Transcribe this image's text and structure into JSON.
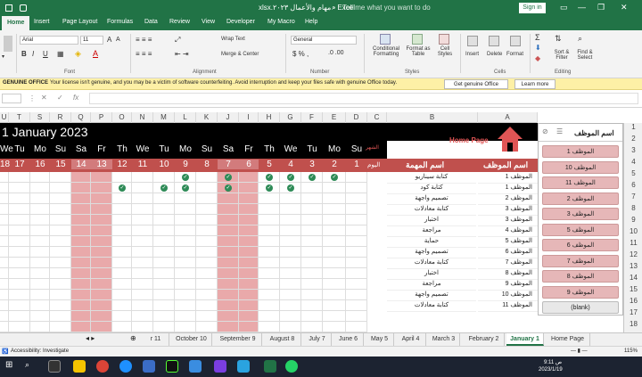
{
  "window": {
    "title": "Excel - مهام والأعمال ٢٠٢٣.xlsx",
    "sign_in": "Sign in"
  },
  "tabs": [
    "Home",
    "Insert",
    "Page Layout",
    "Formulas",
    "Data",
    "Review",
    "View",
    "Developer",
    "My Macro",
    "Help",
    "Tell me what you want to do"
  ],
  "ribbon": {
    "font_name": "Arial",
    "font_size": "11",
    "wrap_text": "Wrap Text",
    "merge_center": "Merge & Center",
    "number_format": "General",
    "conditional_formatting": "Conditional Formatting",
    "format_as_table": "Format as Table",
    "cell_styles": "Cell Styles",
    "insert": "Insert",
    "delete": "Delete",
    "format": "Format",
    "sort_filter": "Sort & Filter",
    "find_select": "Find & Select",
    "groups": [
      "Font",
      "Alignment",
      "Number",
      "Styles",
      "Cells",
      "Editing"
    ]
  },
  "message_bar": {
    "label": "GENUINE OFFICE",
    "text": "Your license isn't genuine, and you may be a victim of software counterfeiting. Avoid interruption and keep your files safe with genuine Office today.",
    "get_genuine": "Get genuine Office",
    "learn_more": "Learn more"
  },
  "columns": [
    "U",
    "T",
    "S",
    "R",
    "Q",
    "P",
    "O",
    "N",
    "M",
    "L",
    "K",
    "J",
    "I",
    "H",
    "G",
    "F",
    "E",
    "D",
    "C",
    "B",
    "A"
  ],
  "sheet": {
    "title": "1 January 2023",
    "home_page": "Home Page",
    "day_names": [
      "We",
      "Tu",
      "Mo",
      "Su",
      "Sa",
      "Fr",
      "Th",
      "We",
      "Tu",
      "Mo",
      "Su",
      "Sa",
      "Fr",
      "Th",
      "We",
      "Tu",
      "Mo",
      "Su"
    ],
    "day_numbers": [
      "18",
      "17",
      "16",
      "15",
      "14",
      "13",
      "12",
      "11",
      "10",
      "9",
      "8",
      "7",
      "6",
      "5",
      "4",
      "3",
      "2",
      "1"
    ],
    "month_label": "الشهر",
    "day_label": "اليوم",
    "col_task": "اسم المهمة",
    "col_employee": "اسم الموظف",
    "rows": [
      {
        "employee": "الموظف 1",
        "task": "كتابة سيناريو"
      },
      {
        "employee": "الموظف 1",
        "task": "كتابة كود"
      },
      {
        "employee": "الموظف 2",
        "task": "تصميم واجهة"
      },
      {
        "employee": "الموظف 3",
        "task": "كتابة معادلات"
      },
      {
        "employee": "الموظف 3",
        "task": "اختبار"
      },
      {
        "employee": "الموظف 4",
        "task": "مراجعة"
      },
      {
        "employee": "الموظف 5",
        "task": "حماية"
      },
      {
        "employee": "الموظف 6",
        "task": "تصميم واجهة"
      },
      {
        "employee": "الموظف 7",
        "task": "كتابة معادلات"
      },
      {
        "employee": "الموظف 8",
        "task": "اختبار"
      },
      {
        "employee": "الموظف 9",
        "task": "مراجعة"
      },
      {
        "employee": "الموظف 10",
        "task": "تصميم واجهة"
      },
      {
        "employee": "الموظف 11",
        "task": "كتابة معادلات"
      }
    ]
  },
  "slicer": {
    "title": "اسم الموظف",
    "items": [
      "الموظف 1",
      "الموظف 10",
      "الموظف 11",
      "الموظف 2",
      "الموظف 3",
      "الموظف 5",
      "الموظف 6",
      "الموظف 7",
      "الموظف 8",
      "الموظف 9",
      "(blank)"
    ]
  },
  "row_numbers": [
    "1",
    "2",
    "3",
    "4",
    "5",
    "6",
    "7",
    "8",
    "9",
    "10",
    "11",
    "12",
    "13",
    "14",
    "15",
    "16",
    "17",
    "18"
  ],
  "sheet_tabs": [
    "r 11",
    "October 10",
    "September 9",
    "August 8",
    "July 7",
    "June 6",
    "May 5",
    "April 4",
    "March 3",
    "February 2",
    "January 1",
    "Home Page"
  ],
  "active_sheet": "January 1",
  "status": {
    "accessibility": "Accessibility: Investigate",
    "zoom": "115%"
  },
  "taskbar": {
    "time": "9:11 ص",
    "date": "2023/1/19"
  },
  "colors": {
    "excel_green": "#217346",
    "title_bg": "#000000",
    "header_red": "#c0504d",
    "weekend_shade": "#e9a9aa",
    "home_red": "#e05555"
  }
}
